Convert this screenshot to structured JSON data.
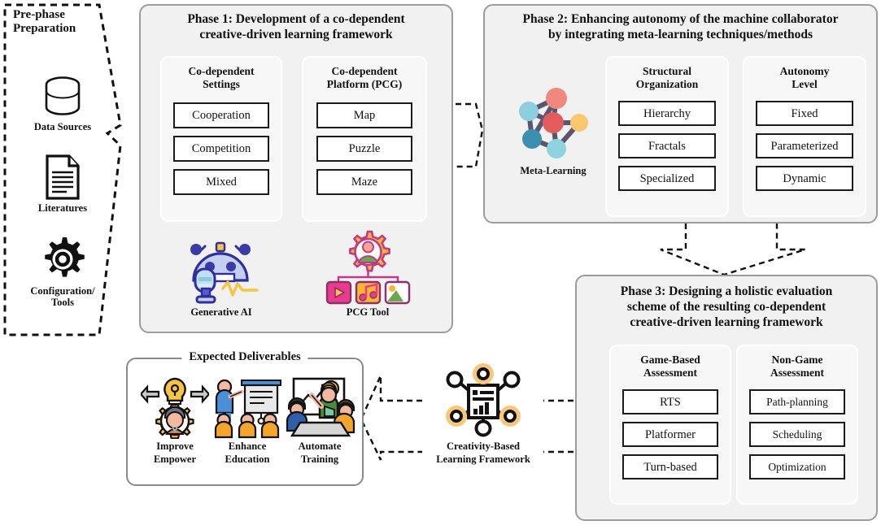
{
  "prephase": {
    "title": "Pre-phase\nPreparation",
    "title_line1": "Pre-phase",
    "title_line2": "Preparation",
    "items": [
      {
        "icon": "database-icon",
        "label": "Data Sources"
      },
      {
        "icon": "document-icon",
        "label": "Literatures"
      },
      {
        "icon": "gear-icon",
        "label_line1": "Configuration/",
        "label_line2": "Tools"
      }
    ]
  },
  "phase1": {
    "title_line1": "Phase 1: Development of a co-dependent",
    "title_line2": "creative-driven learning framework",
    "panels": [
      {
        "title_line1": "Co-dependent",
        "title_line2": "Settings",
        "items": [
          "Cooperation",
          "Competition",
          "Mixed"
        ]
      },
      {
        "title_line1": "Co-dependent",
        "title_line2": "Platform (PCG)",
        "items": [
          "Map",
          "Puzzle",
          "Maze"
        ]
      }
    ],
    "icons": [
      {
        "icon": "robot-ai-icon",
        "label": "Generative AI"
      },
      {
        "icon": "pcg-gear-media-icon",
        "label": "PCG Tool"
      }
    ]
  },
  "phase2": {
    "title_line1": "Phase 2: Enhancing autonomy of the machine collaborator",
    "title_line2": "by integrating meta-learning techniques/methods",
    "icon": {
      "icon": "neural-network-icon",
      "label": "Meta-Learning"
    },
    "panels": [
      {
        "title_line1": "Structural",
        "title_line2": "Organization",
        "items": [
          "Hierarchy",
          "Fractals",
          "Specialized"
        ]
      },
      {
        "title_line1": "Autonomy",
        "title_line2": "Level",
        "items": [
          "Fixed",
          "Parameterized",
          "Dynamic"
        ]
      }
    ]
  },
  "phase3": {
    "title_line1": "Phase 3: Designing a holistic evaluation",
    "title_line2": "scheme of the resulting co-dependent",
    "title_line3": "creative-driven learning framework",
    "panels": [
      {
        "title_line1": "Game-Based",
        "title_line2": "Assessment",
        "items": [
          "RTS",
          "Platformer",
          "Turn-based"
        ]
      },
      {
        "title_line1": "Non-Game",
        "title_line2": "Assessment",
        "items": [
          "Path-planning",
          "Scheduling",
          "Optimization"
        ]
      }
    ]
  },
  "framework_icon": {
    "icon": "network-report-icon",
    "label_line1": "Creativity-Based",
    "label_line2": "Learning Framework"
  },
  "deliverables": {
    "legend": "Expected Deliverables",
    "items": [
      {
        "icon": "improve-empower-icon",
        "label_line1": "Improve",
        "label_line2": "Empower"
      },
      {
        "icon": "enhance-education-icon",
        "label_line1": "Enhance",
        "label_line2": "Education"
      },
      {
        "icon": "automate-training-icon",
        "label_line1": "Automate",
        "label_line2": "Training"
      }
    ]
  },
  "colors": {
    "phase_bg": "#f1f1f1",
    "phase_border": "#9c9c9c",
    "subpanel_bg": "#f7f7f7",
    "item_border": "#1b1b1b",
    "accent_yellow": "#f7c444",
    "accent_navy": "#3b3ba8",
    "accent_pink": "#e8308a",
    "accent_orange": "#f4a62a",
    "net_node_red": "#e25c5c",
    "net_node_salmon": "#f0887e",
    "net_node_lightblue": "#8ecfdf",
    "net_node_steelblue": "#3d8fb0",
    "net_node_yellow": "#fac76e",
    "net_edge": "#5b5570"
  }
}
